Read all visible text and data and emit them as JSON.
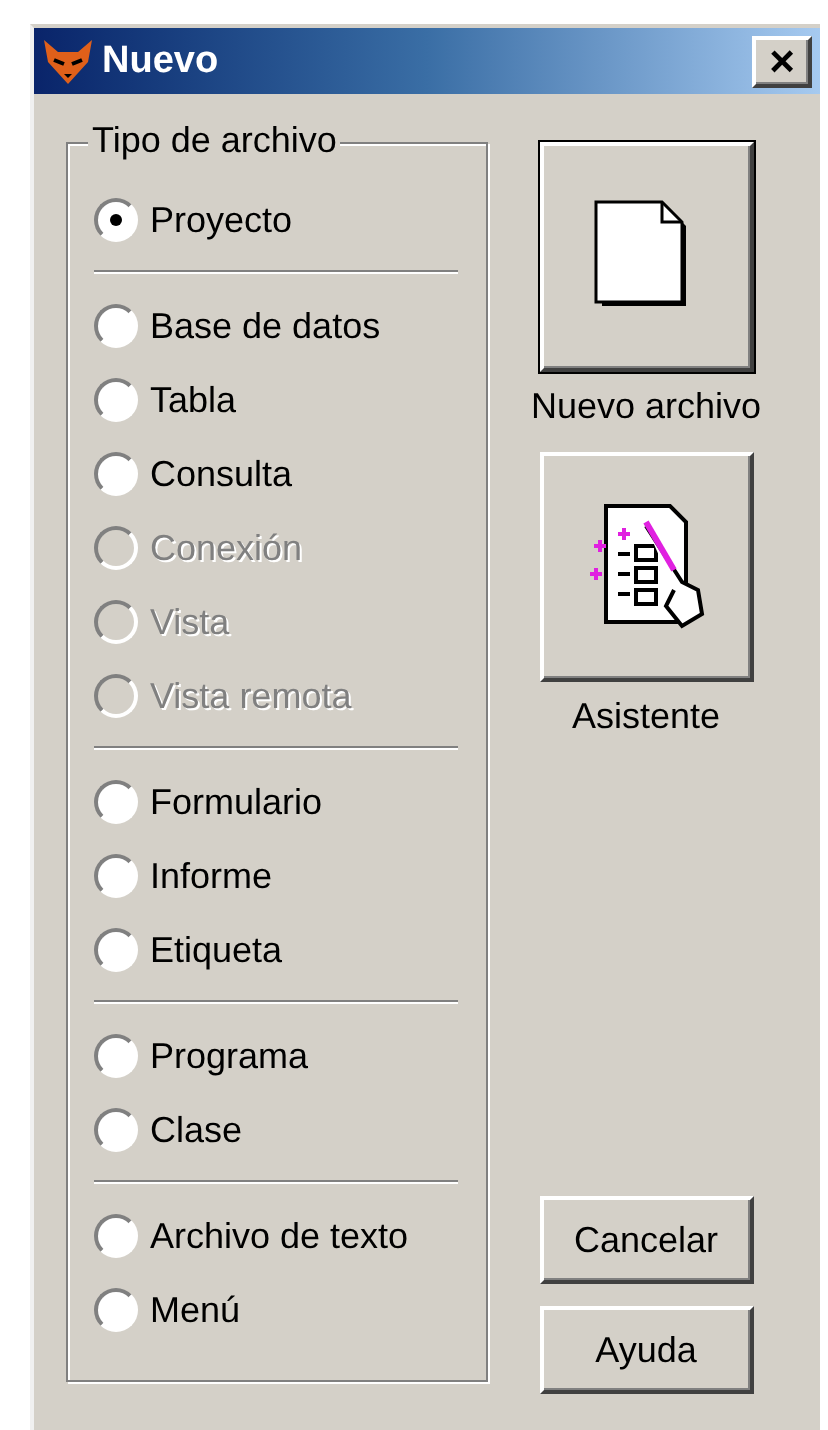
{
  "window": {
    "title": "Nuevo",
    "close": "×"
  },
  "file_type": {
    "title": "Tipo de archivo",
    "groups": [
      {
        "options": [
          {
            "label": "Proyecto",
            "selected": true,
            "disabled": false
          }
        ]
      },
      {
        "options": [
          {
            "label": "Base de datos",
            "selected": false,
            "disabled": false
          },
          {
            "label": "Tabla",
            "selected": false,
            "disabled": false
          },
          {
            "label": "Consulta",
            "selected": false,
            "disabled": false
          },
          {
            "label": "Conexión",
            "selected": false,
            "disabled": true
          },
          {
            "label": "Vista",
            "selected": false,
            "disabled": true
          },
          {
            "label": "Vista remota",
            "selected": false,
            "disabled": true
          }
        ]
      },
      {
        "options": [
          {
            "label": "Formulario",
            "selected": false,
            "disabled": false
          },
          {
            "label": "Informe",
            "selected": false,
            "disabled": false
          },
          {
            "label": "Etiqueta",
            "selected": false,
            "disabled": false
          }
        ]
      },
      {
        "options": [
          {
            "label": "Programa",
            "selected": false,
            "disabled": false
          },
          {
            "label": "Clase",
            "selected": false,
            "disabled": false
          }
        ]
      },
      {
        "options": [
          {
            "label": "Archivo de texto",
            "selected": false,
            "disabled": false
          },
          {
            "label": "Menú",
            "selected": false,
            "disabled": false
          }
        ]
      }
    ]
  },
  "actions": [
    {
      "kind": "new_file",
      "label": "Nuevo archivo"
    },
    {
      "kind": "wizard",
      "label": "Asistente"
    }
  ],
  "buttons": [
    {
      "label": "Cancelar"
    },
    {
      "label": "Ayuda"
    }
  ]
}
